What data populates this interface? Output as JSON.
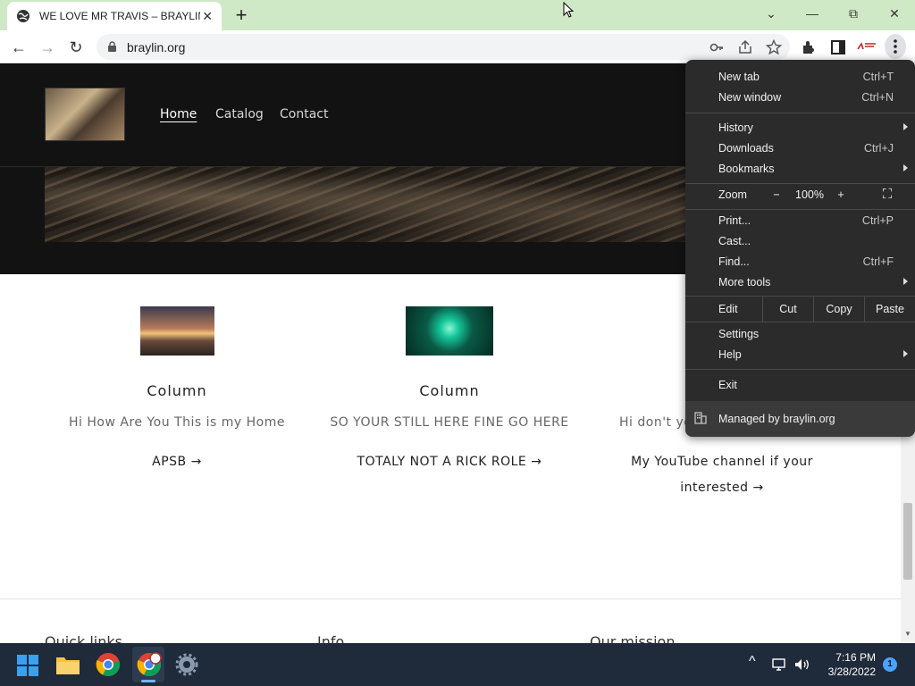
{
  "browser": {
    "tab_title": "WE LOVE MR TRAVIS – BRAYLIN.C",
    "url": "braylin.org",
    "controls": {
      "close_tab": "✕",
      "new_tab": "+",
      "dropdown": "⌄",
      "minimize": "—",
      "restore": "⧉",
      "close_window": "✕",
      "back": "←",
      "forward": "→",
      "reload": "↻"
    }
  },
  "site": {
    "nav": [
      "Home",
      "Catalog",
      "Contact"
    ],
    "columns": [
      {
        "title": "Column",
        "text": "Hi How Are You This is my Home",
        "link": "APSB →"
      },
      {
        "title": "Column",
        "text": "SO YOUR STILL HERE FINE GO HERE",
        "link": "TOTALY NOT A RICK ROLE →"
      },
      {
        "title": "Column",
        "text": "Hi don't yo",
        "link_line1": "My YouTube channel if your",
        "link_line2": "interested →"
      }
    ],
    "footer": [
      "Quick links",
      "Info",
      "Our mission"
    ]
  },
  "menu": {
    "new_tab": {
      "label": "New tab",
      "shortcut": "Ctrl+T"
    },
    "new_window": {
      "label": "New window",
      "shortcut": "Ctrl+N"
    },
    "history": {
      "label": "History"
    },
    "downloads": {
      "label": "Downloads",
      "shortcut": "Ctrl+J"
    },
    "bookmarks": {
      "label": "Bookmarks"
    },
    "zoom": {
      "label": "Zoom",
      "minus": "−",
      "value": "100%",
      "plus": "+",
      "fullscreen": "⛶"
    },
    "print": {
      "label": "Print...",
      "shortcut": "Ctrl+P"
    },
    "cast": {
      "label": "Cast..."
    },
    "find": {
      "label": "Find...",
      "shortcut": "Ctrl+F"
    },
    "more_tools": {
      "label": "More tools"
    },
    "edit": {
      "label": "Edit",
      "cut": "Cut",
      "copy": "Copy",
      "paste": "Paste"
    },
    "settings": {
      "label": "Settings"
    },
    "help": {
      "label": "Help"
    },
    "exit": {
      "label": "Exit"
    },
    "managed": {
      "label": "Managed by braylin.org"
    }
  },
  "scrollbar": {
    "up": "▲",
    "down": "▼"
  },
  "taskbar": {
    "time": "7:16 PM",
    "date": "3/28/2022",
    "notifications": "1",
    "tray_chevron": "^"
  }
}
